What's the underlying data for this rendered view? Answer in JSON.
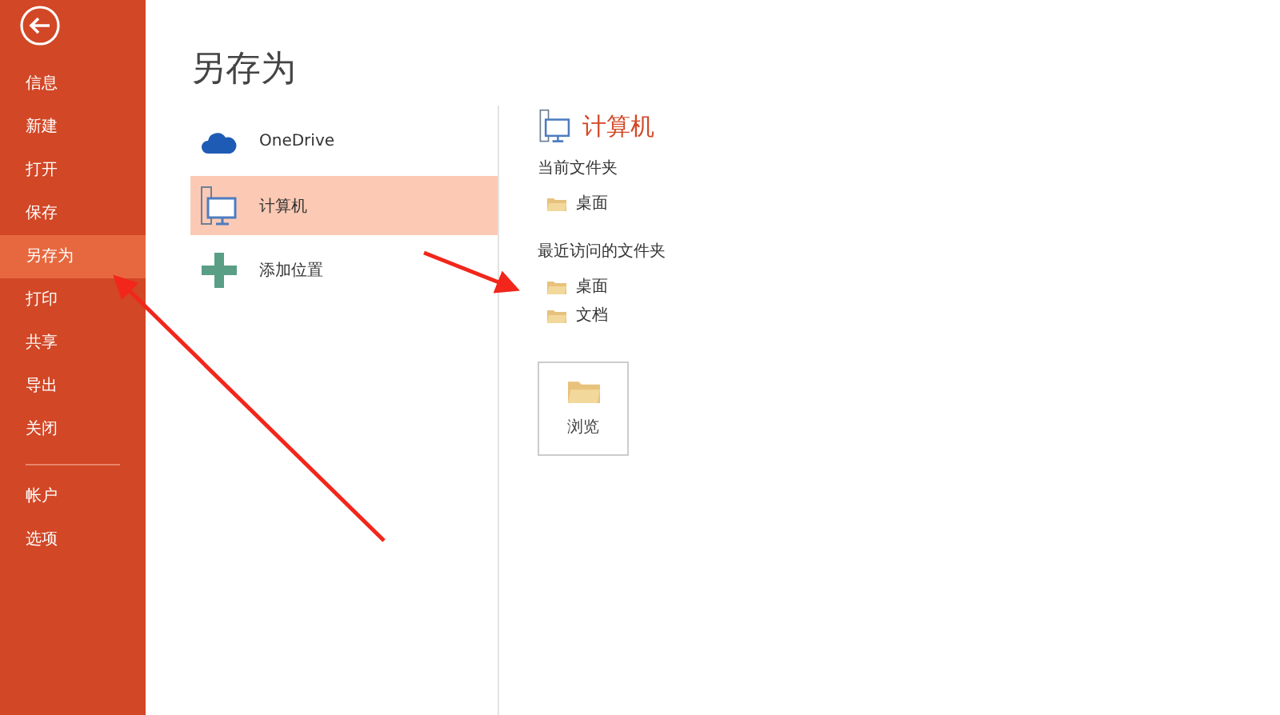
{
  "sidebar": {
    "items": [
      {
        "label": "信息",
        "selected": false
      },
      {
        "label": "新建",
        "selected": false
      },
      {
        "label": "打开",
        "selected": false
      },
      {
        "label": "保存",
        "selected": false
      },
      {
        "label": "另存为",
        "selected": true
      },
      {
        "label": "打印",
        "selected": false
      },
      {
        "label": "共享",
        "selected": false
      },
      {
        "label": "导出",
        "selected": false
      },
      {
        "label": "关闭",
        "selected": false
      }
    ],
    "footer_items": [
      {
        "label": "帐户",
        "selected": false
      },
      {
        "label": "选项",
        "selected": false
      }
    ]
  },
  "title": "另存为",
  "places": [
    {
      "kind": "onedrive",
      "label": "OneDrive",
      "selected": false
    },
    {
      "kind": "computer",
      "label": "计算机",
      "selected": true
    },
    {
      "kind": "add",
      "label": "添加位置",
      "selected": false
    }
  ],
  "detail": {
    "heading": "计算机",
    "sections": [
      {
        "title": "当前文件夹",
        "folders": [
          "桌面"
        ]
      },
      {
        "title": "最近访问的文件夹",
        "folders": [
          "桌面",
          "文档"
        ]
      }
    ],
    "browse_button": "浏览"
  }
}
